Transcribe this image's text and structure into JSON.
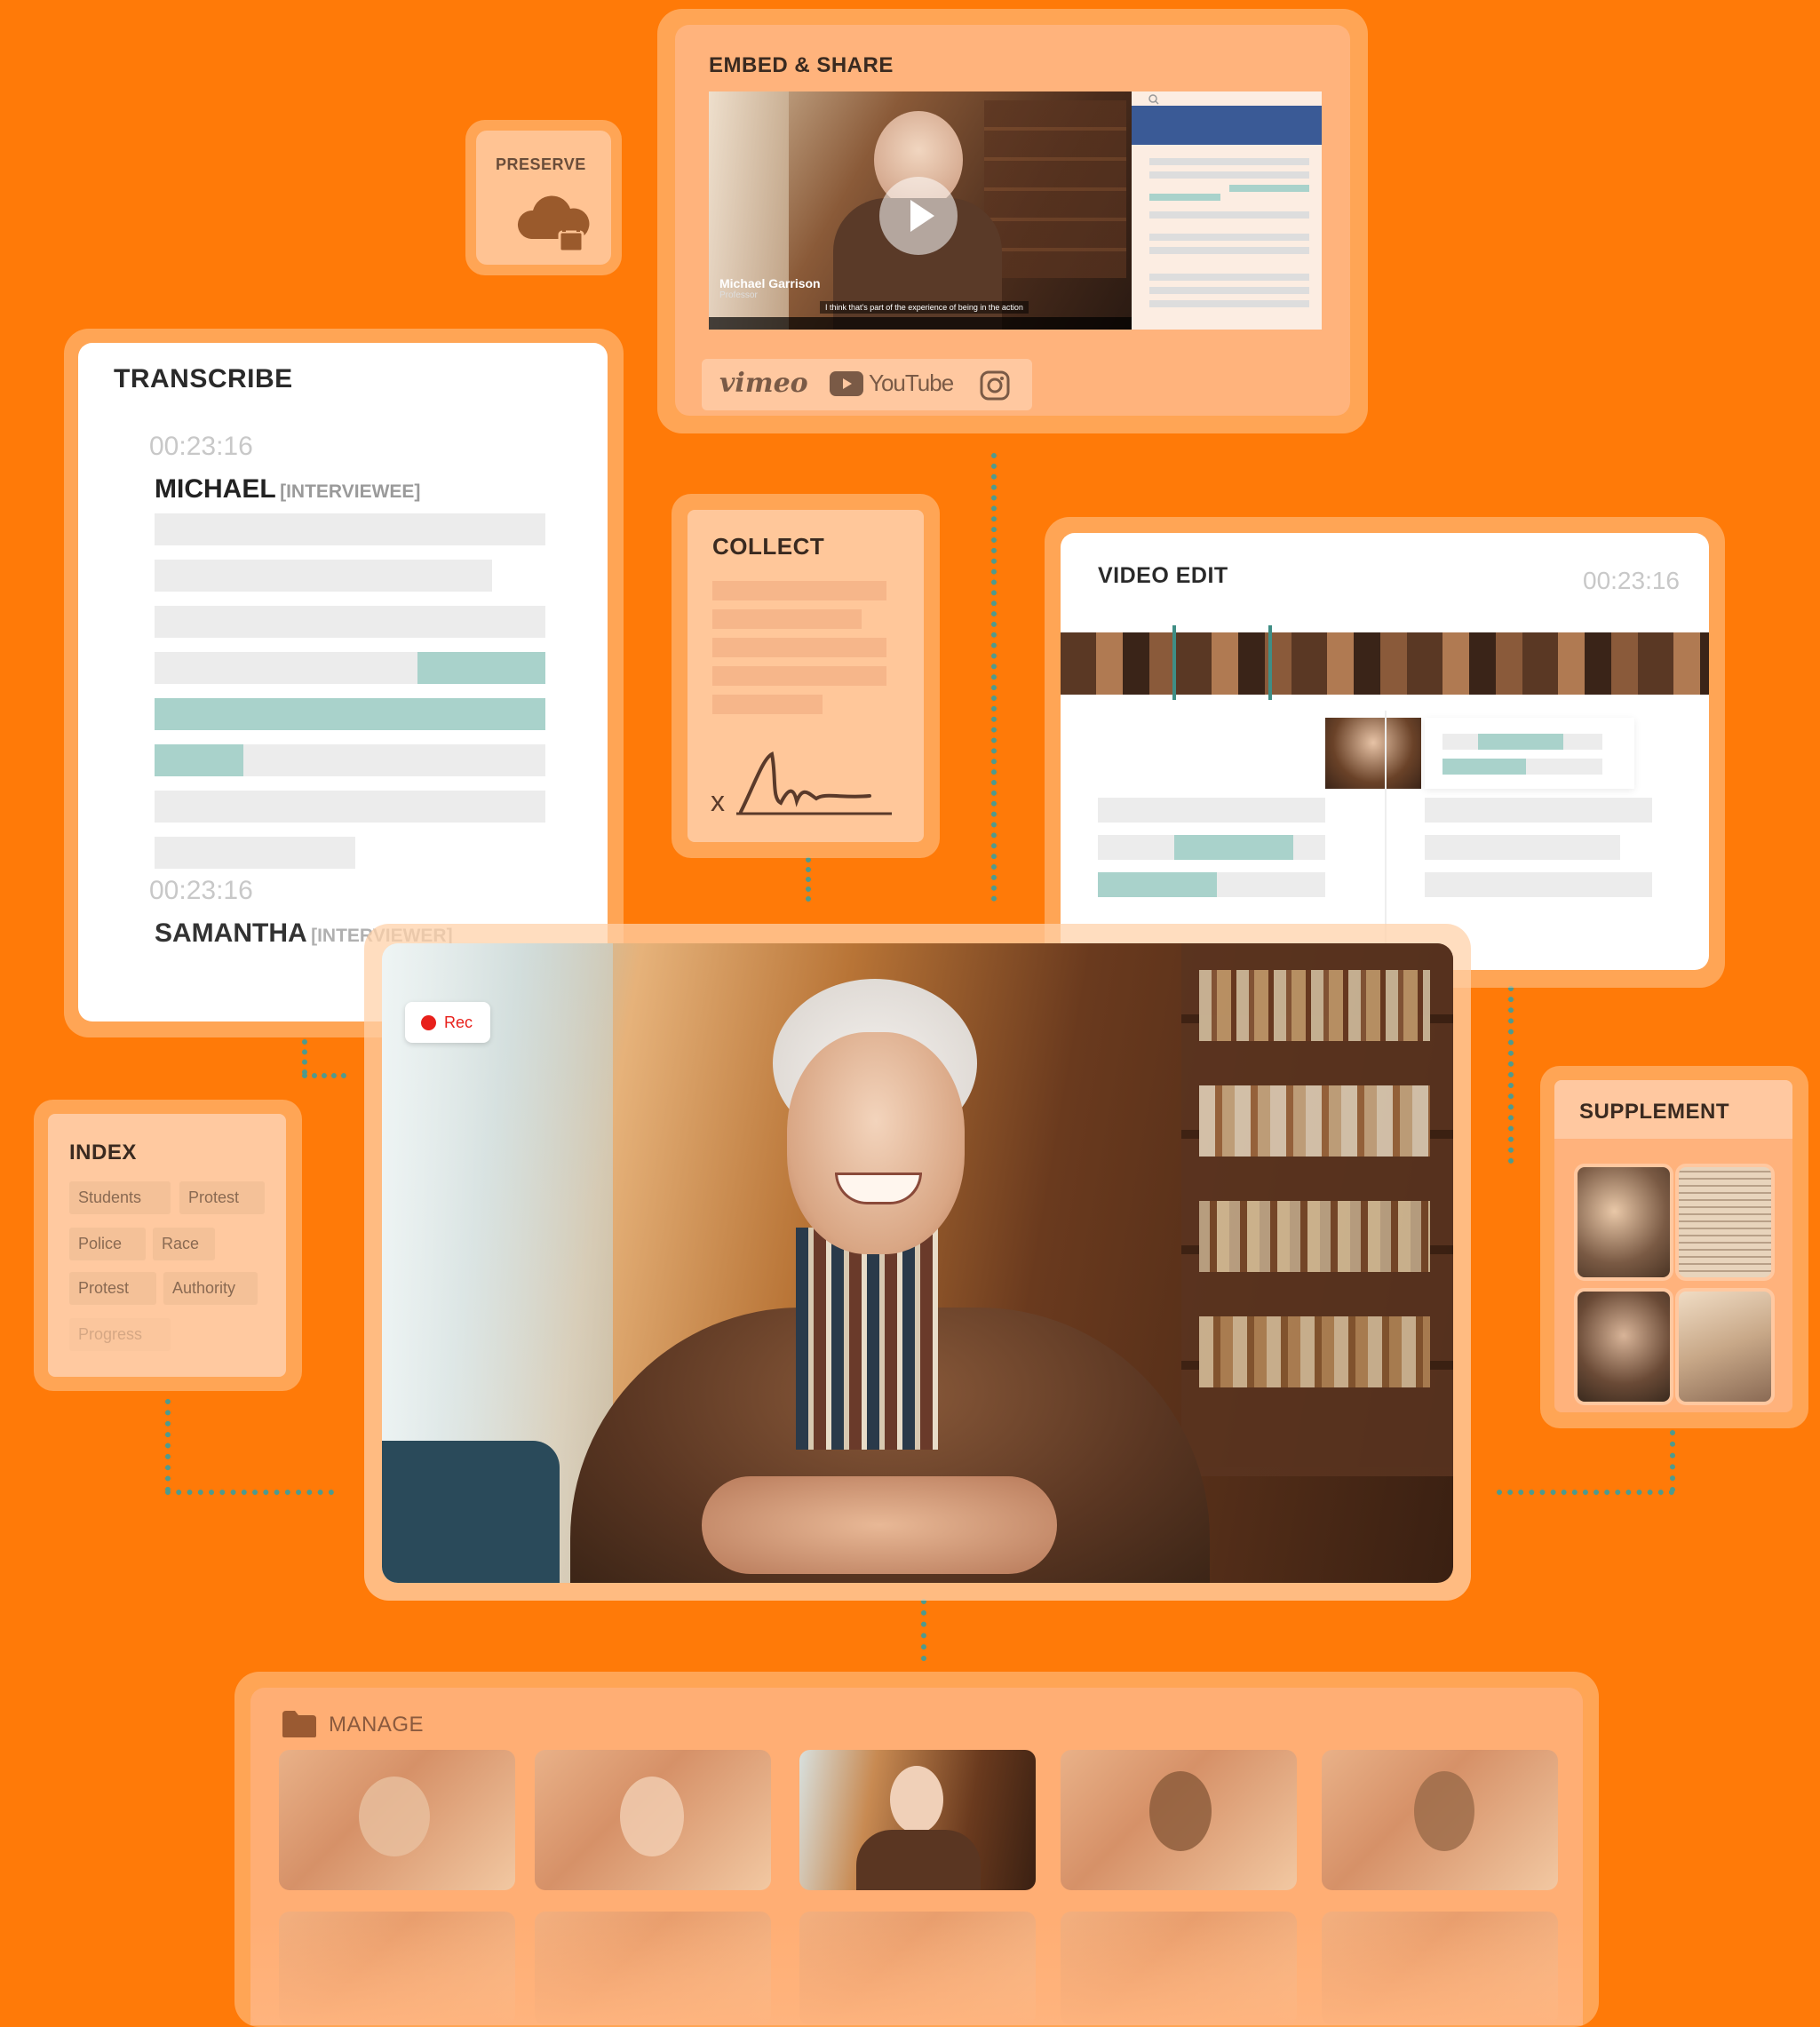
{
  "preserve": {
    "title": "PRESERVE"
  },
  "embed": {
    "title": "EMBED & SHARE",
    "video_name": "Michael Garrison",
    "video_role": "Professor",
    "caption": "I think that's part of the experience of being in the action",
    "platforms": {
      "vimeo": "vimeo",
      "youtube": "YouTube"
    }
  },
  "transcribe": {
    "title": "TRANSCRIBE",
    "entries": [
      {
        "time": "00:23:16",
        "speaker": "MICHAEL",
        "role": "[INTERVIEWEE]"
      },
      {
        "time": "00:23:16",
        "speaker": "SAMANTHA",
        "role": "[INTERVIEWER]"
      }
    ]
  },
  "collect": {
    "title": "COLLECT",
    "sign_mark": "x"
  },
  "video_edit": {
    "title": "VIDEO EDIT",
    "timecode": "00:23:16"
  },
  "recorder": {
    "rec_label": "Rec"
  },
  "index": {
    "title": "INDEX",
    "tags": [
      "Students",
      "Protest",
      "Police",
      "Race",
      "Protest",
      "Authority",
      "Progress"
    ]
  },
  "supplement": {
    "title": "SUPPLEMENT"
  },
  "manage": {
    "title": "MANAGE"
  },
  "colors": {
    "background": "#FF7A08",
    "accent_teal": "#A9D2CB",
    "rec_red": "#E8201B"
  }
}
